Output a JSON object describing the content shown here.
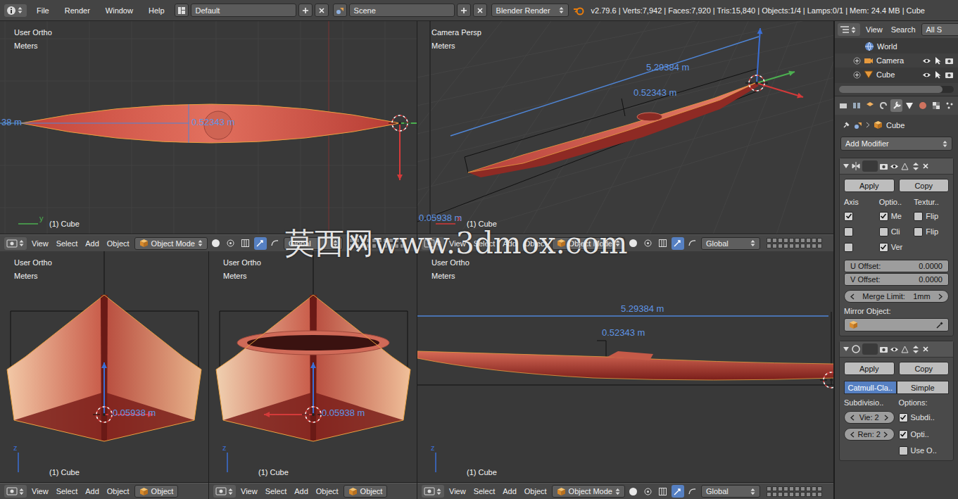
{
  "topbar": {
    "menus": [
      "File",
      "Render",
      "Window",
      "Help"
    ],
    "layout": "Default",
    "scene": "Scene",
    "engine": "Blender Render",
    "stats": "v2.79.6 | Verts:7,942 | Faces:7,920 | Tris:15,840 | Objects:1/4 | Lamps:0/1 | Mem: 24.4 MB | Cube"
  },
  "viewports": [
    {
      "kind": "top",
      "view": "User Ortho",
      "units": "Meters",
      "object": "(1) Cube",
      "dims": [
        "38 m",
        "0.52343 m"
      ],
      "axes": [
        {
          "label": "y",
          "color": "#4caf50",
          "kind": "right"
        }
      ],
      "header": {
        "menus": [
          "View",
          "Select",
          "Add",
          "Object"
        ],
        "mode": "Object Mode",
        "orientation": "Global"
      }
    },
    {
      "kind": "camera",
      "view": "Camera Persp",
      "units": "Meters",
      "object": "(1) Cube",
      "dims": [
        "5.29384 m",
        "0.52343 m",
        "0.05938 m"
      ],
      "axes": [
        {
          "label": "x",
          "color": "#d43a3a",
          "kind": "right"
        }
      ],
      "header": {
        "menus": [
          "View",
          "Select",
          "Add",
          "Object"
        ],
        "mode": "Object Mode",
        "orientation": "Global"
      }
    },
    {
      "kind": "front",
      "view": "User Ortho",
      "units": "Meters",
      "object": "(1) Cube",
      "dims": [
        "0.05938 m"
      ],
      "axes": [
        {
          "label": "z",
          "color": "#3b6fd6",
          "kind": "up"
        }
      ],
      "header": {
        "menus": [
          "View",
          "Select",
          "Add",
          "Object"
        ],
        "mode": "Object"
      }
    },
    {
      "kind": "back",
      "view": "User Ortho",
      "units": "Meters",
      "object": "(1) Cube",
      "dims": [
        "0.05938 m"
      ],
      "axes": [
        {
          "label": "z",
          "color": "#3b6fd6",
          "kind": "up"
        }
      ],
      "header": {
        "menus": [
          "View",
          "Select",
          "Add",
          "Object"
        ],
        "mode": "Object"
      }
    },
    {
      "kind": "side",
      "view": "User Ortho",
      "units": "Meters",
      "object": "(1) Cube",
      "dims": [
        "5.29384 m",
        "0.52343 m"
      ],
      "axes": [
        {
          "label": "z",
          "color": "#3b6fd6",
          "kind": "up"
        }
      ],
      "header": {
        "menus": [
          "View",
          "Select",
          "Add",
          "Object"
        ],
        "mode": "Object Mode",
        "orientation": "Global"
      }
    }
  ],
  "watermark": "莫西网www.3dmox.com",
  "outliner": {
    "menus": [
      "View",
      "Search"
    ],
    "filter": "All S",
    "items": [
      {
        "name": "World",
        "kind": "world"
      },
      {
        "name": "Camera",
        "kind": "camera"
      },
      {
        "name": "Cube",
        "kind": "mesh"
      }
    ]
  },
  "properties": {
    "tabs": [
      {
        "selected": false
      },
      {
        "selected": false
      },
      {
        "selected": false
      },
      {
        "selected": false
      },
      {
        "selected": true
      },
      {
        "selected": false
      },
      {
        "selected": false
      },
      {
        "selected": false
      },
      {
        "selected": false
      }
    ],
    "breadcrumb": "Cube",
    "add_modifier": "Add Modifier",
    "mirror": {
      "buttons": [
        "Apply",
        "Copy"
      ],
      "columns": [
        "Axis",
        "Optio..",
        "Textur.."
      ],
      "checks": [
        {
          "label": "",
          "checked": true
        },
        {
          "label": "Me",
          "checked": true
        },
        {
          "label": "Flip",
          "checked": false
        },
        {
          "label": "",
          "checked": false
        },
        {
          "label": "Cli",
          "checked": false
        },
        {
          "label": "Flip",
          "checked": false
        },
        {
          "label": "",
          "checked": false
        },
        {
          "label": "Ver",
          "checked": true
        }
      ],
      "offsets": [
        {
          "label": "U Offset:",
          "value": "0.0000"
        },
        {
          "label": "V Offset:",
          "value": "0.0000"
        }
      ],
      "merge": {
        "label": "Merge Limit:",
        "value": "1mm"
      },
      "mirror_object": {
        "label": "Mirror Object:"
      }
    },
    "subsurf": {
      "buttons": [
        "Apply",
        "Copy"
      ],
      "types": [
        {
          "label": "Catmull-Cla..",
          "selected": true
        },
        {
          "label": "Simple",
          "selected": false
        }
      ],
      "labels": [
        "Subdivisio..",
        "Options:"
      ],
      "levels": [
        "Vie: 2",
        "Ren: 2"
      ],
      "options": [
        {
          "label": "Subdi..",
          "checked": true
        },
        {
          "label": "Opti..",
          "checked": true
        },
        {
          "label": "Use O..",
          "checked": false
        }
      ]
    }
  }
}
